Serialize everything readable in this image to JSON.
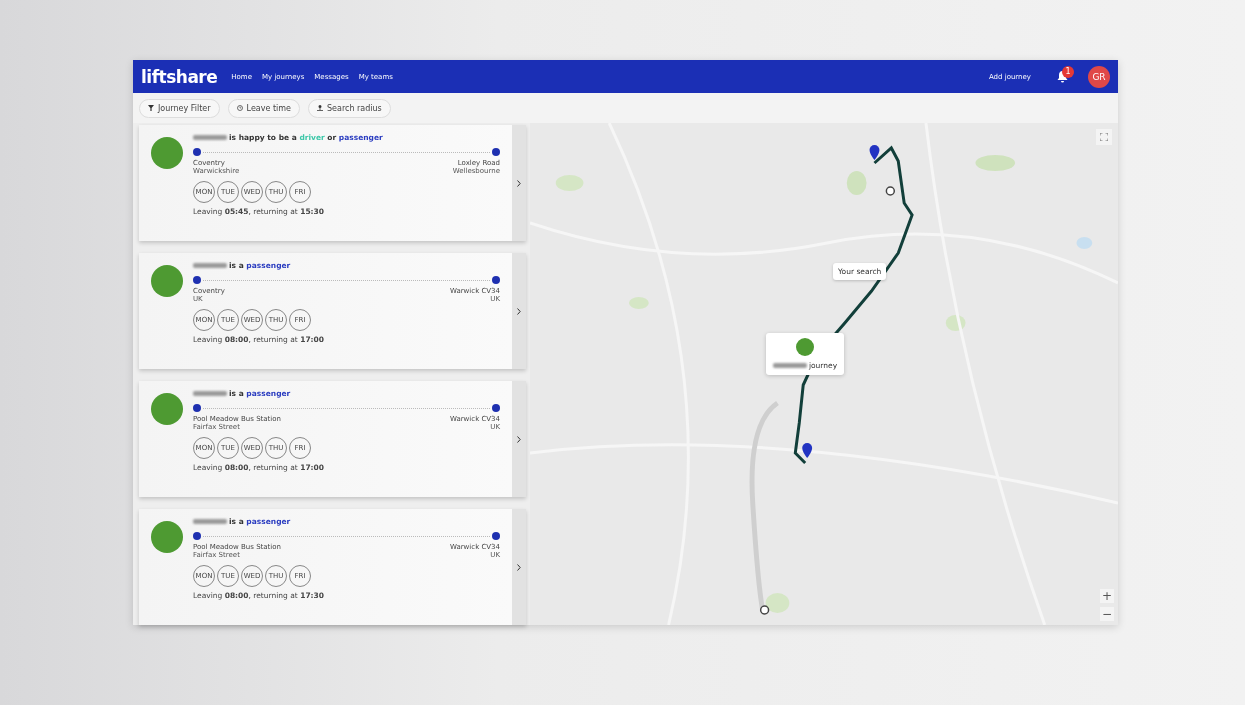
{
  "nav": {
    "logo": "liftshare",
    "links": [
      "Home",
      "My journeys",
      "Messages",
      "My teams"
    ],
    "add_journey": "Add journey",
    "notifications": "1",
    "avatar": "GR"
  },
  "filters": [
    {
      "label": "Journey Filter",
      "kind": "filter"
    },
    {
      "label": "Leave time",
      "kind": "clock"
    },
    {
      "label": "Search radius",
      "kind": "radius"
    }
  ],
  "journeys": [
    {
      "phrase": [
        {
          "text": "is happy to be a",
          "kind": "plain"
        },
        {
          "text": "driver",
          "kind": "driver"
        },
        {
          "text": "or",
          "kind": "plain"
        },
        {
          "text": "passenger",
          "kind": "passenger"
        }
      ],
      "from": "Coventry",
      "from_sub": "Warwickshire",
      "to": "Loxley Road",
      "to_sub": "Wellesbourne",
      "days": [
        "MON",
        "TUE",
        "WED",
        "THU",
        "FRI"
      ],
      "times": "Leaving **05:45**, returning at **15:30**"
    },
    {
      "phrase": [
        {
          "text": "is a",
          "kind": "plain"
        },
        {
          "text": "passenger",
          "kind": "passenger"
        }
      ],
      "from": "Coventry",
      "from_sub": "UK",
      "to": "Warwick CV34",
      "to_sub": "UK",
      "days": [
        "MON",
        "TUE",
        "WED",
        "THU",
        "FRI"
      ],
      "times": "Leaving **08:00**, returning at **17:00**"
    },
    {
      "phrase": [
        {
          "text": "is a",
          "kind": "plain"
        },
        {
          "text": "passenger",
          "kind": "passenger"
        }
      ],
      "from": "Pool Meadow Bus Station",
      "from_sub": "Fairfax Street",
      "to": "Warwick CV34",
      "to_sub": "UK",
      "days": [
        "MON",
        "TUE",
        "WED",
        "THU",
        "FRI"
      ],
      "times": "Leaving **08:00**, returning at **17:00**"
    },
    {
      "phrase": [
        {
          "text": "is a",
          "kind": "plain"
        },
        {
          "text": "passenger",
          "kind": "passenger"
        }
      ],
      "from": "Pool Meadow Bus Station",
      "from_sub": "Fairfax Street",
      "to": "Warwick CV34",
      "to_sub": "UK",
      "days": [
        "MON",
        "TUE",
        "WED",
        "THU",
        "FRI"
      ],
      "times": "Leaving **08:00**, returning at **17:30**"
    }
  ],
  "map": {
    "search_label": "Your search",
    "popup_label": "journey",
    "zoom_in": "+",
    "zoom_out": "−"
  }
}
